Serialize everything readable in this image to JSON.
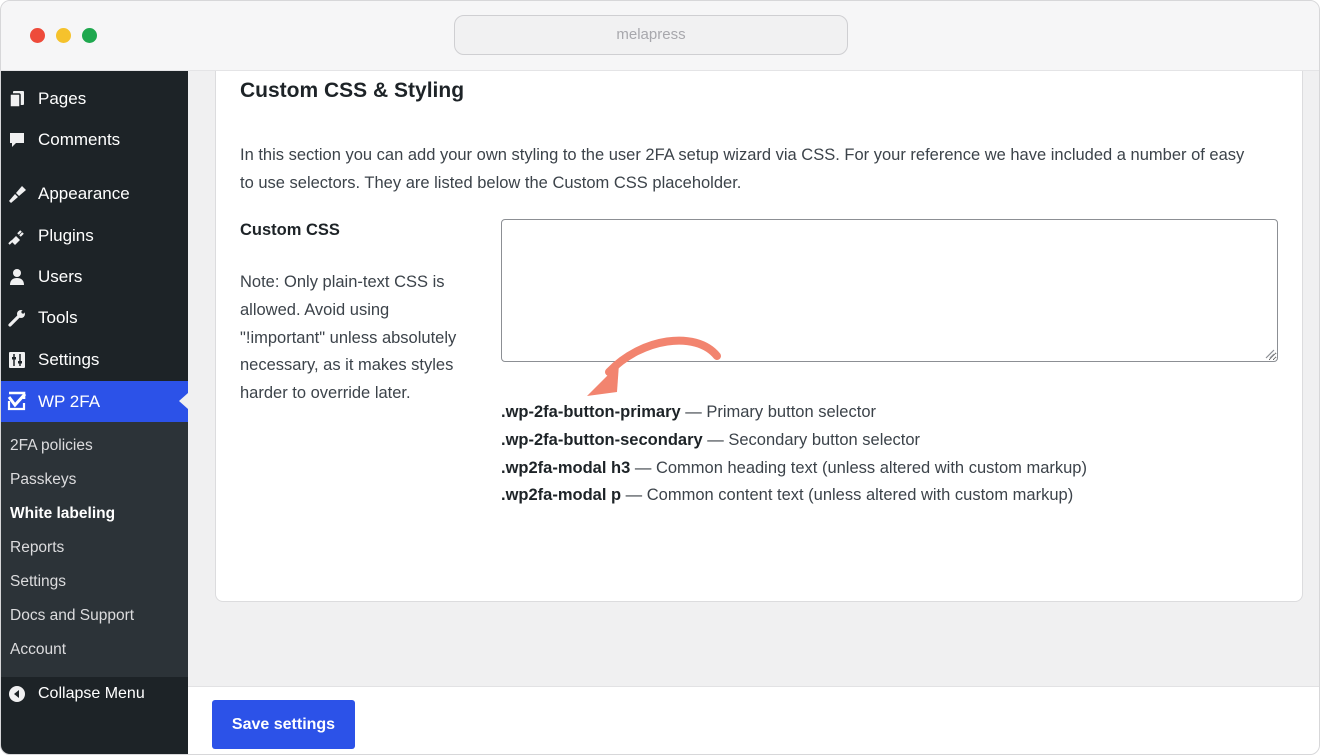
{
  "browser": {
    "url": "melapress"
  },
  "sidebar": {
    "items": [
      {
        "label": "Pages",
        "icon": "pages-icon"
      },
      {
        "label": "Comments",
        "icon": "comments-icon"
      },
      {
        "label": "Appearance",
        "icon": "appearance-icon"
      },
      {
        "label": "Plugins",
        "icon": "plugins-icon"
      },
      {
        "label": "Users",
        "icon": "users-icon"
      },
      {
        "label": "Tools",
        "icon": "tools-icon"
      },
      {
        "label": "Settings",
        "icon": "settings-icon"
      },
      {
        "label": "WP 2FA",
        "icon": "wp2fa-icon",
        "active": true
      }
    ],
    "submenu": [
      {
        "label": "2FA policies"
      },
      {
        "label": "Passkeys"
      },
      {
        "label": "White labeling",
        "current": true
      },
      {
        "label": "Reports"
      },
      {
        "label": "Settings"
      },
      {
        "label": "Docs and Support"
      },
      {
        "label": "Account"
      }
    ],
    "collapse_label": "Collapse Menu"
  },
  "main": {
    "title": "Custom CSS & Styling",
    "description": "In this section you can add your own styling to the user 2FA setup wizard via CSS. For your reference we have included a number of easy to use selectors. They are listed below the Custom CSS placeholder.",
    "field_label": "Custom CSS",
    "field_note": "Note: Only plain-text CSS is allowed. Avoid using \"!important\" unless absolutely necessary, as it makes styles harder to override later.",
    "textarea_value": "",
    "selectors": [
      {
        "selector": ".wp-2fa-button-primary",
        "desc": " — Primary button selector"
      },
      {
        "selector": ".wp-2fa-button-secondary",
        "desc": " — Secondary button selector"
      },
      {
        "selector": ".wp2fa-modal h3",
        "desc": " — Common heading text (unless altered with custom markup)"
      },
      {
        "selector": ".wp2fa-modal p",
        "desc": " — Common content text (unless altered with custom markup)"
      }
    ]
  },
  "footer": {
    "save_label": "Save settings"
  },
  "colors": {
    "accent": "#2c52e8",
    "sidebar_bg": "#1d2327",
    "submenu_bg": "#2c3338",
    "annotation_arrow": "#f2846f"
  }
}
